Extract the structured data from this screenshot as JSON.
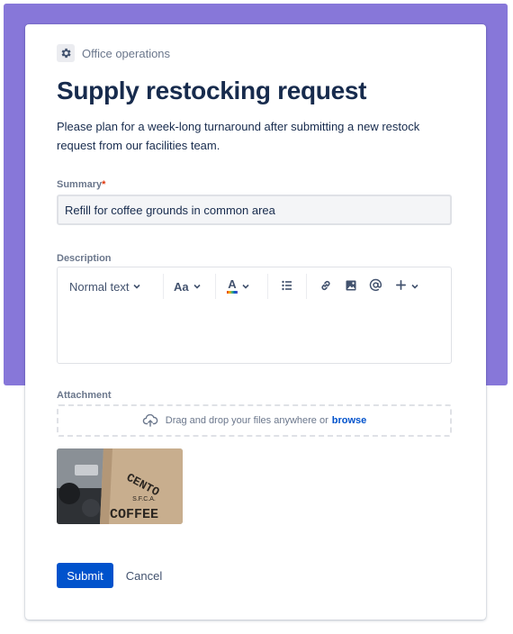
{
  "header": {
    "project_name": "Office operations",
    "project_icon": "gear-icon",
    "title": "Supply restocking request",
    "description": "Please plan for a week-long turnaround after submitting a new restock request from our facilities team."
  },
  "form": {
    "summary": {
      "label": "Summary",
      "required_mark": "*",
      "value": "Refill for coffee grounds in common area"
    },
    "description": {
      "label": "Description",
      "toolbar": {
        "text_style": "Normal text",
        "font_button": "Aa",
        "text_color_button": "A",
        "items": [
          "chevron-down-icon",
          "font-size-icon",
          "text-color-icon",
          "bullet-list-icon",
          "link-icon",
          "image-icon",
          "mention-icon",
          "insert-plus-icon"
        ]
      }
    },
    "attachment": {
      "label": "Attachment",
      "drop_text": "Drag and drop your files anywhere or",
      "browse_link": "browse",
      "thumbnail_text_line1": "CENTO",
      "thumbnail_text_line2": "S.F.C.A.",
      "thumbnail_text_line3": "COFFEE"
    },
    "actions": {
      "submit_label": "Submit",
      "cancel_label": "Cancel"
    }
  },
  "colors": {
    "banner": "#8777D9",
    "primary": "#0052CC",
    "text": "#172B4D",
    "subtle_text": "#6B778C",
    "required": "#DE350B"
  }
}
